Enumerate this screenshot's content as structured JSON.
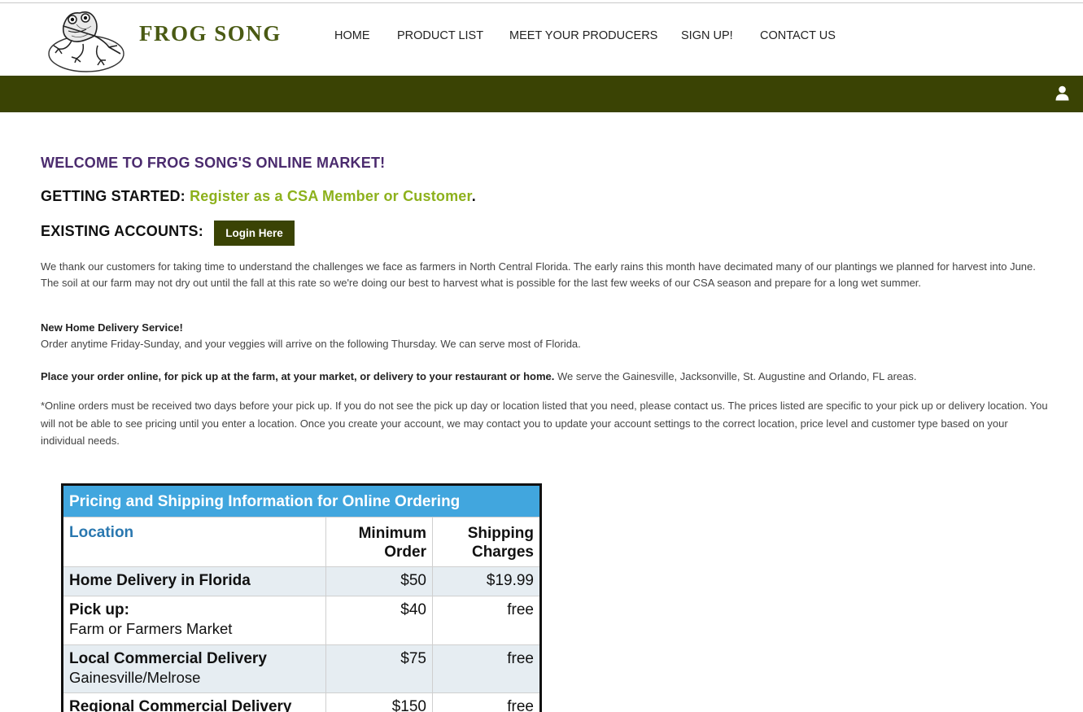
{
  "header": {
    "logo_text": "FROG SONG",
    "nav": [
      "HOME",
      "PRODUCT LIST",
      "MEET YOUR PRODUCERS",
      "SIGN UP!",
      "CONTACT US"
    ]
  },
  "colors": {
    "brand_green": "#3a4304",
    "logo_text": "#4a5a14",
    "welcome_purple": "#4b2b6e",
    "link_green": "#8db11c",
    "table_header_blue": "#41a6de",
    "table_location_blue": "#2a78b0"
  },
  "icons": {
    "user": "user-icon",
    "logo": "frog-logo"
  },
  "main": {
    "welcome": "WELCOME TO FROG SONG'S ONLINE MARKET!",
    "getting_started_label": "GETTING STARTED:",
    "register_link": "Register as a CSA Member or Customer",
    "register_period": ".",
    "existing_label": "EXISTING ACCOUNTS:",
    "login_button": "Login Here",
    "intro": "We thank our customers for taking time to understand the challenges we face as farmers in North Central Florida. The early rains this month have decimated many of our plantings we planned for harvest into June. The soil at our farm may not dry out until the fall at this rate so we're doing our best to harvest what is possible for the last few weeks of our CSA season and prepare for a long wet summer.",
    "delivery_heading": "New Home Delivery Service!",
    "delivery_text": "Order anytime Friday-Sunday, and your veggies will arrive on the following Thursday. We can serve most of Florida.",
    "order_bold": "Place your order online, for pick up at the farm, at your market, or delivery to your restaurant or home.",
    "order_text": " We serve the Gainesville, Jacksonville, St. Augustine and Orlando, FL areas.",
    "note": "*Online orders must be received two days before your pick up. If you do not see the pick up day or location listed that you need, please contact us. The prices listed are specific to your pick up or delivery location. You will not be able to see pricing until you enter a location. Once you create your account, we may contact you to update your account settings to the correct location, price level and customer type based on your individual needs."
  },
  "pricing_table": {
    "title": "Pricing and Shipping Information for Online Ordering",
    "columns": [
      "Location",
      "Minimum Order",
      "Shipping Charges"
    ],
    "rows": [
      {
        "location": "Home Delivery in Florida",
        "sub": "",
        "minimum": "$50",
        "shipping": "$19.99"
      },
      {
        "location": "Pick up:",
        "sub": "Farm or Farmers Market",
        "minimum": "$40",
        "shipping": "free"
      },
      {
        "location": "Local Commercial Delivery",
        "sub": "Gainesville/Melrose",
        "minimum": "$75",
        "shipping": "free"
      },
      {
        "location": "Regional Commercial Delivery",
        "sub": "",
        "minimum": "$150",
        "shipping": "free"
      }
    ]
  }
}
